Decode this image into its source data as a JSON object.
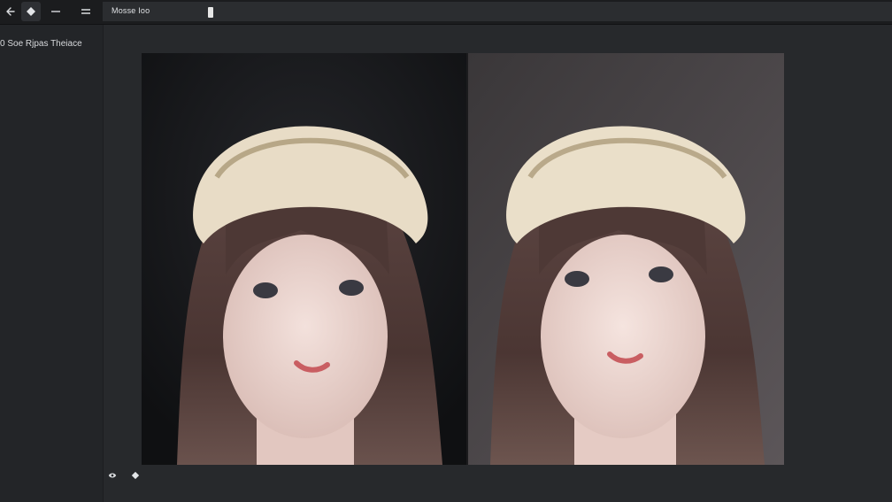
{
  "toolbar": {
    "buttons": [
      {
        "name": "back-icon"
      },
      {
        "name": "diamond-icon"
      },
      {
        "name": "minus-icon"
      },
      {
        "name": "menu-icon"
      }
    ],
    "title": "Mosse Ioo"
  },
  "sidebar": {
    "items": [
      {
        "label": "0 Soe Rjpas Theiace"
      }
    ]
  },
  "canvas": {
    "images": [
      {
        "name": "portrait-left"
      },
      {
        "name": "portrait-right"
      }
    ]
  },
  "footer": {
    "icons": [
      {
        "name": "eye-icon"
      },
      {
        "name": "diamond-icon"
      }
    ]
  },
  "colors": {
    "background": "#242629",
    "toolbar": "#1b1c1e",
    "field": "#2b2d30",
    "text": "#d4d6d9"
  }
}
